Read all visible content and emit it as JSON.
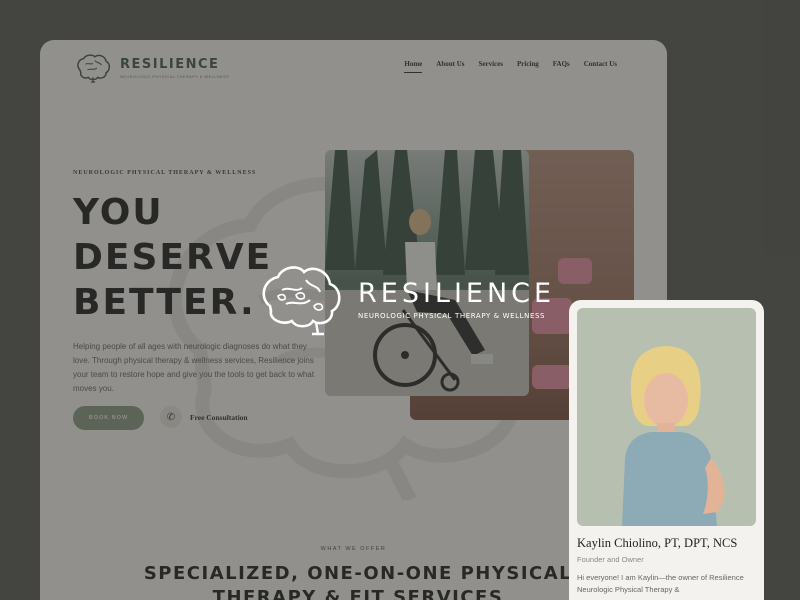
{
  "brand": {
    "name": "RESILIENCE",
    "tagline": "NEUROLOGIC PHYSICAL THERAPY & WELLNESS"
  },
  "nav": {
    "items": [
      {
        "label": "Home",
        "active": true
      },
      {
        "label": "About Us",
        "active": false
      },
      {
        "label": "Services",
        "active": false
      },
      {
        "label": "Pricing",
        "active": false
      },
      {
        "label": "FAQs",
        "active": false
      },
      {
        "label": "Contact Us",
        "active": false
      }
    ]
  },
  "hero": {
    "eyebrow": "NEUROLOGIC PHYSICAL THERAPY & WELLNESS",
    "headline_lines": [
      "YOU",
      "DESERVE",
      "BETTER."
    ],
    "intro": "Helping people of all ages with neurologic diagnoses do what they love. Through physical therapy & wellness services, Resilience joins your team to restore hope and give you the tools to get back to what moves you.",
    "book_button": "BOOK NOW",
    "consult_label": "Free Consultation",
    "phone_icon": "phone-icon"
  },
  "services": {
    "eyebrow": "WHAT WE OFFER",
    "title": "SPECIALIZED, ONE-ON-ONE PHYSICAL THERAPY & FIT SERVICES"
  },
  "overlay_logo": {
    "name": "RESILIENCE",
    "tagline": "NEUROLOGIC PHYSICAL THERAPY & WELLNESS"
  },
  "profile": {
    "name": "Kaylin Chiolino, PT, DPT, NCS",
    "role": "Founder and Owner",
    "bio": "Hi everyone! I am Kaylin—the owner of Resilience Neurologic Physical Therapy &"
  },
  "colors": {
    "background": "#5a5a57",
    "card": "#f4f3ef",
    "accent_sage": "#8a9a84",
    "dumbbell_pink": "#e48fa4"
  }
}
